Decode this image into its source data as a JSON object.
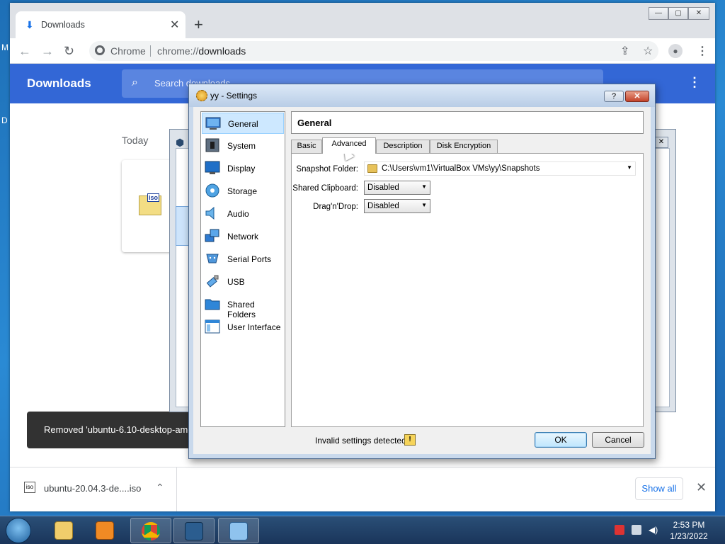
{
  "desktop": {
    "edge_letters": [
      "M",
      "D"
    ]
  },
  "chrome": {
    "tab": {
      "title": "Downloads",
      "icon": "download-icon",
      "close": "✕"
    },
    "new_tab": "+",
    "window_buttons": {
      "minimize": "—",
      "maximize": "▢",
      "close": "✕"
    },
    "omnibox": {
      "scheme_label": "Chrome",
      "url_prefix": "chrome://",
      "url_host": "downloads"
    },
    "page": {
      "title": "Downloads",
      "search_placeholder": "Search downloads",
      "section_label": "Today",
      "toast_text": "Removed 'ubuntu-6.10-desktop-amd"
    },
    "shelf": {
      "file_name": "ubuntu-20.04.3-de....iso",
      "file_icon_label": "iso",
      "show_all": "Show all"
    }
  },
  "settings": {
    "window_title": "yy - Settings",
    "help_btn": "?",
    "close_btn": "✕",
    "nav": [
      {
        "label": "General",
        "icon": "general-icon",
        "selected": true
      },
      {
        "label": "System",
        "icon": "system-icon"
      },
      {
        "label": "Display",
        "icon": "display-icon"
      },
      {
        "label": "Storage",
        "icon": "storage-icon"
      },
      {
        "label": "Audio",
        "icon": "audio-icon"
      },
      {
        "label": "Network",
        "icon": "network-icon"
      },
      {
        "label": "Serial Ports",
        "icon": "serial-ports-icon"
      },
      {
        "label": "USB",
        "icon": "usb-icon"
      },
      {
        "label": "Shared Folders",
        "icon": "shared-folders-icon"
      },
      {
        "label": "User Interface",
        "icon": "user-interface-icon"
      }
    ],
    "section_title": "General",
    "tabs": [
      {
        "label": "Basic"
      },
      {
        "label": "Advanced",
        "active": true
      },
      {
        "label": "Description"
      },
      {
        "label": "Disk Encryption"
      }
    ],
    "fields": {
      "snapshot_folder": {
        "label": "Snapshot Folder:",
        "value": "C:\\Users\\vm1\\VirtualBox VMs\\yy\\Snapshots"
      },
      "shared_clipboard": {
        "label": "Shared Clipboard:",
        "value": "Disabled"
      },
      "drag_n_drop": {
        "label": "Drag'n'Drop:",
        "value": "Disabled"
      }
    },
    "status": "Invalid settings detected",
    "ok": "OK",
    "cancel": "Cancel"
  },
  "taskbar": {
    "apps": [
      {
        "name": "explorer-icon"
      },
      {
        "name": "media-player-icon"
      },
      {
        "name": "chrome-icon",
        "open": true
      },
      {
        "name": "virtualbox-icon",
        "open": true
      },
      {
        "name": "control-panel-icon",
        "open": true
      }
    ],
    "time": "2:53 PM",
    "date": "1/23/2022"
  }
}
